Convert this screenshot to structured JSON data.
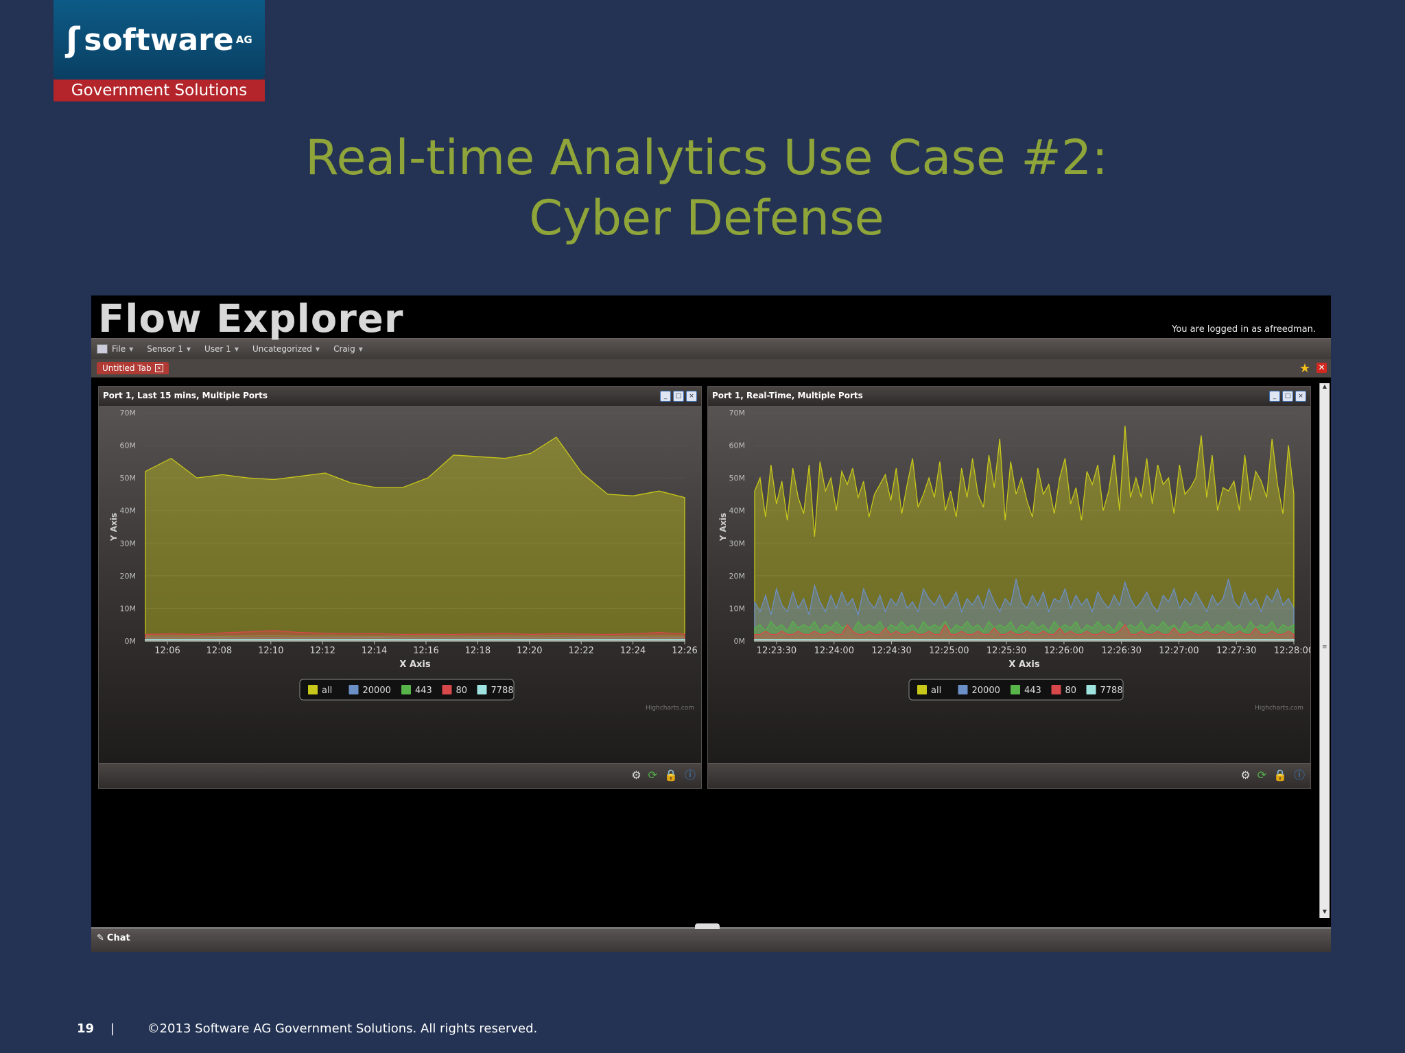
{
  "logo": {
    "brand": "software",
    "suffix": "AG",
    "division": "Government Solutions"
  },
  "slide": {
    "title_line1": "Real-time Analytics Use Case #2:",
    "title_line2": "Cyber Defense",
    "page_number": "19",
    "separator": "|",
    "copyright": "©2013 Software AG Government Solutions. All rights reserved."
  },
  "app": {
    "title": "Flow Explorer",
    "login_text": "You are logged in as afreedman.",
    "menu": [
      {
        "label": "File"
      },
      {
        "label": "Sensor 1"
      },
      {
        "label": "User 1"
      },
      {
        "label": "Uncategorized"
      },
      {
        "label": "Craig"
      }
    ],
    "tab_label": "Untitled Tab",
    "chat_label": "Chat",
    "colors": {
      "accent_tab": "#b03a34",
      "close_red": "#d2281f",
      "star": "#f2c01a"
    }
  },
  "panels": [
    {
      "title": "Port 1, Last 15 mins, Multiple Ports",
      "credit": "Highcharts.com"
    },
    {
      "title": "Port 1, Real-Time, Multiple Ports",
      "credit": "Highcharts.com"
    }
  ],
  "chart_data": [
    {
      "type": "area",
      "title": "Port 1, Last 15 mins, Multiple Ports",
      "xlabel": "X Axis",
      "ylabel": "Y Axis",
      "ylim": [
        0,
        70
      ],
      "yticks": [
        "0M",
        "10M",
        "20M",
        "30M",
        "40M",
        "50M",
        "60M",
        "70M"
      ],
      "xticks": [
        "12:06",
        "12:08",
        "12:10",
        "12:12",
        "12:14",
        "12:16",
        "12:18",
        "12:20",
        "12:22",
        "12:24",
        "12:26"
      ],
      "x": [
        0,
        1,
        2,
        3,
        4,
        5,
        6,
        7,
        8,
        9,
        10,
        11,
        12,
        13,
        14,
        15,
        16,
        17,
        18,
        19,
        20,
        21
      ],
      "legend_placement": "bottom-center",
      "series": [
        {
          "name": "all",
          "color": "#c8c81a",
          "values": [
            52,
            56,
            50,
            51,
            50,
            49.5,
            50.5,
            51.5,
            48.5,
            47,
            47,
            50,
            57,
            56.5,
            56,
            57.5,
            62.5,
            51.5,
            45,
            44.5,
            46,
            44
          ]
        },
        {
          "name": "20000",
          "color": "#6b8fc7",
          "values": [
            1,
            1,
            1,
            1,
            1,
            1,
            1,
            1,
            1,
            1,
            1,
            1,
            1,
            1,
            1,
            1,
            1,
            1,
            1,
            1,
            1,
            1
          ]
        },
        {
          "name": "443",
          "color": "#57b54a",
          "values": [
            1.5,
            1.6,
            1.5,
            1.4,
            1.6,
            1.7,
            1.5,
            1.6,
            1.5,
            1.4,
            1.5,
            1.6,
            1.5,
            1.5,
            1.6,
            1.5,
            1.7,
            1.5,
            1.4,
            1.5,
            1.6,
            1.5
          ]
        },
        {
          "name": "80",
          "color": "#d8474a",
          "values": [
            2,
            2.2,
            2,
            2.5,
            2.8,
            3.2,
            2.6,
            2.4,
            2.2,
            2.3,
            2,
            2.1,
            2,
            2.2,
            2.4,
            2,
            2.3,
            2.1,
            2,
            2.2,
            2.6,
            2.1
          ]
        },
        {
          "name": "7788",
          "color": "#9fe3e0",
          "values": [
            0.5,
            0.5,
            0.5,
            0.5,
            0.5,
            0.5,
            0.5,
            0.5,
            0.5,
            0.5,
            0.5,
            0.5,
            0.5,
            0.5,
            0.5,
            0.5,
            0.5,
            0.5,
            0.5,
            0.5,
            0.5,
            0.5
          ]
        }
      ]
    },
    {
      "type": "area",
      "title": "Port 1, Real-Time, Multiple Ports",
      "xlabel": "X Axis",
      "ylabel": "Y Axis",
      "ylim": [
        0,
        70
      ],
      "yticks": [
        "0M",
        "10M",
        "20M",
        "30M",
        "40M",
        "50M",
        "60M",
        "70M"
      ],
      "xticks": [
        "12:23:30",
        "12:24:00",
        "12:24:30",
        "12:25:00",
        "12:25:30",
        "12:26:00",
        "12:26:30",
        "12:27:00",
        "12:27:30",
        "12:28:00"
      ],
      "legend_placement": "bottom-center",
      "series": [
        {
          "name": "all",
          "color": "#c8c81a",
          "values": [
            46,
            50,
            38,
            54,
            42,
            49,
            37,
            53,
            44,
            39,
            54,
            32,
            55,
            46,
            50,
            40,
            52,
            48,
            53,
            44,
            49,
            38,
            45,
            48,
            51,
            43,
            53,
            39,
            48,
            56,
            41,
            45,
            50,
            44,
            55,
            40,
            46,
            38,
            53,
            44,
            56,
            45,
            41,
            57,
            47,
            62,
            37,
            55,
            45,
            50,
            43,
            38,
            53,
            45,
            48,
            39,
            50,
            56,
            42,
            47,
            37,
            52,
            48,
            54,
            40,
            46,
            57,
            40,
            66,
            44,
            50,
            44,
            56,
            42,
            54,
            48,
            50,
            39,
            54,
            45,
            47,
            50,
            63,
            44,
            57,
            40,
            47,
            46,
            49,
            40,
            57,
            43,
            52,
            49,
            44,
            62,
            48,
            39,
            60,
            45
          ]
        },
        {
          "name": "20000",
          "color": "#6b8fc7",
          "values": [
            12,
            9,
            14,
            8,
            16,
            11,
            9,
            15,
            10,
            13,
            8,
            17,
            12,
            9,
            14,
            10,
            15,
            11,
            13,
            8,
            16,
            12,
            10,
            14,
            9,
            13,
            11,
            15,
            10,
            12,
            9,
            16,
            13,
            11,
            14,
            10,
            12,
            15,
            9,
            13,
            11,
            14,
            10,
            16,
            12,
            9,
            13,
            11,
            19,
            12,
            10,
            14,
            11,
            15,
            9,
            13,
            12,
            16,
            10,
            14,
            11,
            13,
            9,
            15,
            12,
            10,
            14,
            11,
            18,
            13,
            10,
            12,
            15,
            11,
            9,
            14,
            12,
            16,
            10,
            13,
            11,
            15,
            12,
            9,
            14,
            11,
            13,
            19,
            12,
            10,
            15,
            11,
            13,
            9,
            14,
            12,
            16,
            11,
            13,
            10
          ]
        },
        {
          "name": "443",
          "color": "#57b54a",
          "values": [
            4,
            5,
            3,
            6,
            4,
            5,
            3,
            6,
            4,
            5,
            4,
            6,
            3,
            5,
            4,
            6,
            4,
            5,
            3,
            6,
            4,
            5,
            4,
            6,
            3,
            5,
            4,
            6,
            4,
            5,
            3,
            6,
            4,
            5,
            4,
            6,
            3,
            5,
            4,
            6,
            4,
            5,
            3,
            6,
            4,
            5,
            4,
            6,
            3,
            5,
            4,
            6,
            4,
            5,
            3,
            6,
            4,
            5,
            4,
            6,
            3,
            5,
            4,
            6,
            4,
            5,
            3,
            6,
            4,
            5,
            4,
            6,
            3,
            5,
            4,
            6,
            4,
            5,
            3,
            6,
            4,
            5,
            4,
            6,
            3,
            5,
            4,
            6,
            4,
            5,
            3,
            6,
            4,
            5,
            4,
            6,
            3,
            5,
            4,
            5
          ]
        },
        {
          "name": "80",
          "color": "#d8474a",
          "values": [
            2,
            2,
            3,
            2,
            2,
            3,
            2,
            2,
            3,
            2,
            2,
            3,
            2,
            2,
            3,
            2,
            2,
            5,
            3,
            2,
            2,
            3,
            2,
            2,
            4,
            2,
            3,
            2,
            2,
            3,
            2,
            2,
            3,
            2,
            2,
            5,
            2,
            2,
            3,
            2,
            2,
            3,
            2,
            2,
            4,
            2,
            2,
            3,
            2,
            2,
            3,
            2,
            2,
            3,
            2,
            2,
            4,
            2,
            3,
            2,
            2,
            3,
            2,
            2,
            3,
            2,
            2,
            3,
            5,
            2,
            2,
            3,
            2,
            2,
            3,
            2,
            2,
            4,
            2,
            2,
            3,
            2,
            2,
            3,
            2,
            2,
            3,
            2,
            2,
            3,
            2,
            2,
            4,
            2,
            2,
            3,
            2,
            2,
            3,
            2
          ]
        },
        {
          "name": "7788",
          "color": "#9fe3e0",
          "values": [
            0.5,
            0.5,
            0.5,
            0.5,
            0.5,
            0.5,
            0.5,
            0.5,
            0.5,
            0.5,
            0.5,
            0.5,
            0.5,
            0.5,
            0.5,
            0.5,
            0.5,
            0.5,
            0.5,
            0.5,
            0.5,
            0.5,
            0.5,
            0.5,
            0.5,
            0.5,
            0.5,
            0.5,
            0.5,
            0.5,
            0.5,
            0.5,
            0.5,
            0.5,
            0.5,
            0.5,
            0.5,
            0.5,
            0.5,
            0.5,
            0.5,
            0.5,
            0.5,
            0.5,
            0.5,
            0.5,
            0.5,
            0.5,
            0.5,
            0.5,
            0.5,
            0.5,
            0.5,
            0.5,
            0.5,
            0.5,
            0.5,
            0.5,
            0.5,
            0.5,
            0.5,
            0.5,
            0.5,
            0.5,
            0.5,
            0.5,
            0.5,
            0.5,
            0.5,
            0.5,
            0.5,
            0.5,
            0.5,
            0.5,
            0.5,
            0.5,
            0.5,
            0.5,
            0.5,
            0.5,
            0.5,
            0.5,
            0.5,
            0.5,
            0.5,
            0.5,
            0.5,
            0.5,
            0.5,
            0.5,
            0.5,
            0.5,
            0.5,
            0.5,
            0.5,
            0.5,
            0.5,
            0.5,
            0.5,
            0.5
          ]
        }
      ]
    }
  ]
}
